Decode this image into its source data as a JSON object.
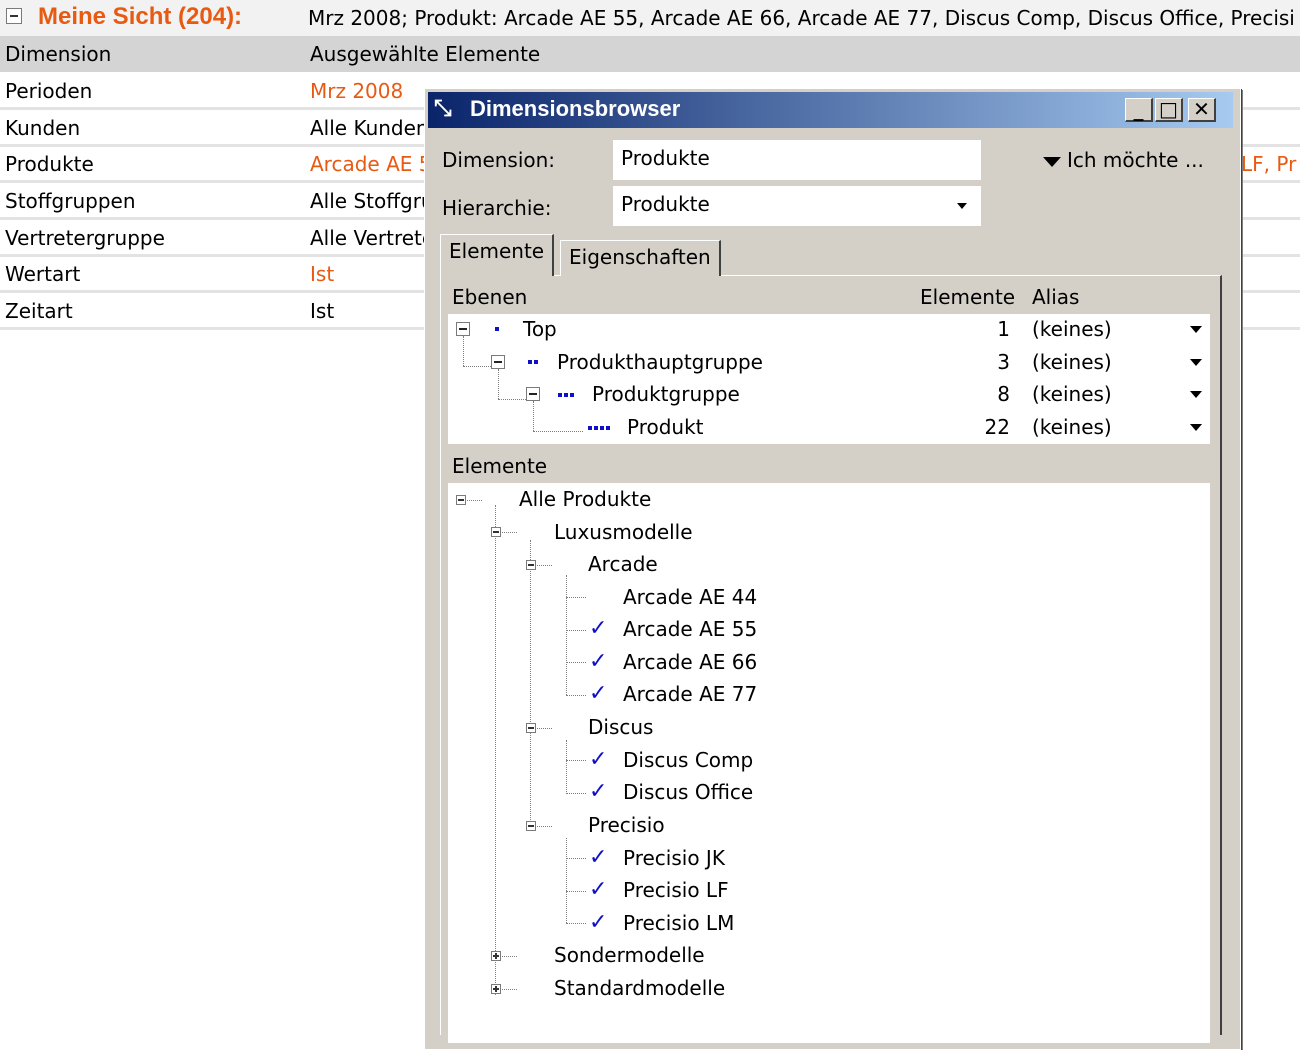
{
  "sheet": {
    "title": "Meine Sicht (204):",
    "summary": "Mrz 2008; Produkt: Arcade AE 55, Arcade AE 66, Arcade AE 77, Discus Comp, Discus Office, Precisi",
    "columns": {
      "dimension": "Dimension",
      "selected": "Ausgewählte Elemente"
    },
    "rows": [
      {
        "label": "Perioden",
        "value": "Mrz 2008"
      },
      {
        "label": "Kunden",
        "value": "Alle Kunden"
      },
      {
        "label": "Produkte",
        "value": "Arcade AE 5"
      },
      {
        "label": "Stoffgruppen",
        "value": "Alle Stoffgru"
      },
      {
        "label": "Vertretergruppe",
        "value": "Alle Vertrete"
      },
      {
        "label": "Wertart",
        "value": "Ist"
      },
      {
        "label": "Zeitart",
        "value": "Ist"
      }
    ],
    "right_fragment": "LF, Pr",
    "colors": {
      "accent": "#e85a12",
      "header": "#d4d4d4"
    }
  },
  "window": {
    "title": "Dimensionsbrowser",
    "icon": "pivot-arrows-icon",
    "buttons": {
      "minimize": "_",
      "maximize": "□",
      "close": "✕"
    },
    "dimension_label": "Dimension:",
    "dimension_value": "Produkte",
    "hierarchy_label": "Hierarchie:",
    "hierarchy_value": "Produkte",
    "ich_moechte": "Ich möchte ...",
    "tabs": [
      "Elemente",
      "Eigenschaften"
    ],
    "levels": {
      "header": "Ebenen",
      "count_header": "Elemente",
      "alias_header": "Alias",
      "items": [
        {
          "name": "Top",
          "count": "1",
          "alias": "(keines)"
        },
        {
          "name": "Produkthauptgruppe",
          "count": "3",
          "alias": "(keines)"
        },
        {
          "name": "Produktgruppe",
          "count": "8",
          "alias": "(keines)"
        },
        {
          "name": "Produkt",
          "count": "22",
          "alias": "(keines)"
        }
      ]
    },
    "elements": {
      "header": "Elemente",
      "tree": [
        {
          "label": "Alle Produkte",
          "checked": false
        },
        {
          "label": "Luxusmodelle",
          "checked": false
        },
        {
          "label": "Arcade",
          "checked": false
        },
        {
          "label": "Arcade AE 44",
          "checked": false
        },
        {
          "label": "Arcade AE 55",
          "checked": true
        },
        {
          "label": "Arcade AE 66",
          "checked": true
        },
        {
          "label": "Arcade AE 77",
          "checked": true
        },
        {
          "label": "Discus",
          "checked": false
        },
        {
          "label": "Discus Comp",
          "checked": true
        },
        {
          "label": "Discus Office",
          "checked": true
        },
        {
          "label": "Precisio",
          "checked": false
        },
        {
          "label": "Precisio JK",
          "checked": true
        },
        {
          "label": "Precisio LF",
          "checked": true
        },
        {
          "label": "Precisio LM",
          "checked": true
        },
        {
          "label": "Sondermodelle",
          "checked": false
        },
        {
          "label": "Standardmodelle",
          "checked": false
        }
      ]
    }
  }
}
